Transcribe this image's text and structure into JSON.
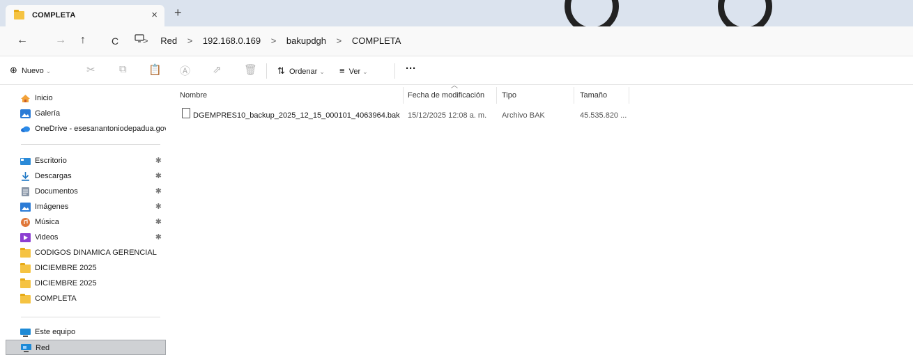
{
  "window": {
    "tab_title": "COMPLETA",
    "tab_close": "×",
    "new_tab": "+"
  },
  "nav": {
    "back": "←",
    "forward": "→",
    "up": "↑",
    "refresh": "C",
    "breadcrumb": [
      "Red",
      "192.168.0.169",
      "bakupdgh",
      "COMPLETA"
    ],
    "sep": ">"
  },
  "toolbar": {
    "new_label": "Nuevo",
    "sort_label": "Ordenar",
    "view_label": "Ver",
    "more": "···"
  },
  "sidebar": {
    "top": [
      {
        "label": "Inicio",
        "icon": "home-icon"
      },
      {
        "label": "Galería",
        "icon": "gallery-icon"
      },
      {
        "label": "OneDrive - esesanantoniodepadua.gov",
        "icon": "onedrive-icon"
      }
    ],
    "pinned": [
      {
        "label": "Escritorio",
        "icon": "desktop-icon",
        "pin": "📌"
      },
      {
        "label": "Descargas",
        "icon": "download-icon",
        "pin": "📌"
      },
      {
        "label": "Documentos",
        "icon": "documents-icon",
        "pin": "📌"
      },
      {
        "label": "Imágenes",
        "icon": "pictures-icon",
        "pin": "📌"
      },
      {
        "label": "Música",
        "icon": "music-icon",
        "pin": "📌"
      },
      {
        "label": "Videos",
        "icon": "videos-icon",
        "pin": "📌"
      }
    ],
    "folders": [
      {
        "label": "CODIGOS DINAMICA GERENCIAL"
      },
      {
        "label": "DICIEMBRE 2025"
      },
      {
        "label": "DICIEMBRE 2025"
      },
      {
        "label": "COMPLETA"
      }
    ],
    "bottom": [
      {
        "label": "Este equipo",
        "icon": "computer-icon"
      },
      {
        "label": "Red",
        "icon": "network-icon",
        "selected": true
      }
    ]
  },
  "columns": {
    "name": "Nombre",
    "modified": "Fecha de modificación",
    "type": "Tipo",
    "size": "Tamaño"
  },
  "files": [
    {
      "name": "DGEMPRES10_backup_2025_12_15_000101_4063964.bak",
      "modified": "15/12/2025 12:08 a. m.",
      "type": "Archivo BAK",
      "size": "45.535.820 ..."
    }
  ]
}
